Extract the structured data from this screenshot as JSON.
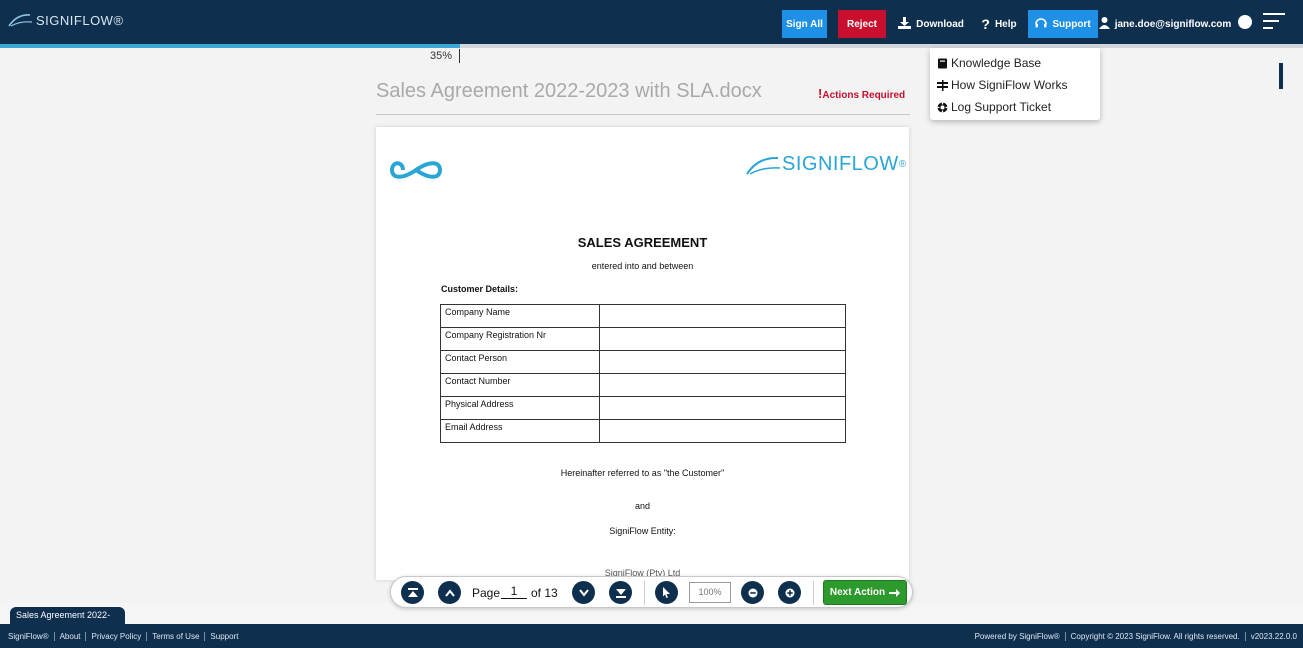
{
  "header": {
    "logo_text": "SIGNIFLOW®",
    "sign_all": "Sign All",
    "reject": "Reject",
    "download": "Download",
    "help": "Help",
    "support": "Support",
    "user_email": "jane.doe@signiflow.com",
    "colors": {
      "bar": "#0f2f4f",
      "sign_all": "#1e90e6",
      "reject": "#c8102e",
      "support": "#1e90e6"
    }
  },
  "support_menu": [
    {
      "label": "Knowledge Base",
      "icon": "book-icon"
    },
    {
      "label": "How SigniFlow Works",
      "icon": "signpost-icon"
    },
    {
      "label": "Log Support Ticket",
      "icon": "lifebuoy-icon"
    }
  ],
  "viewer": {
    "zoom_label": "35%",
    "document_title": "Sales Agreement 2022-2023 with SLA.docx",
    "actions_required": "Actions Required"
  },
  "document": {
    "logo_text": "SIGNIFLOW",
    "title": "SALES AGREEMENT",
    "subtitle": "entered into and between",
    "customer_label": "Customer Details:",
    "customer_fields": [
      "Company Name",
      "Company Registration Nr",
      "Contact Person",
      "Contact Number",
      "Physical Address",
      "Email Address"
    ],
    "hereinafter": "Hereinafter referred to as \"the Customer\"",
    "and": "and",
    "entity": "SigniFlow Entity:",
    "cut_text": "SigniFlow (Pty) Ltd"
  },
  "toolbar": {
    "page_label": "Page",
    "page_number": "1",
    "page_of": "of 13",
    "zoom_placeholder": "100%",
    "next_action": "Next Action"
  },
  "doc_tab": "Sales Agreement 2022-",
  "footer": {
    "left": [
      "SigniFlow®",
      "About",
      "Privacy Policy",
      "Terms of Use",
      "Support"
    ],
    "right": [
      "Powered by SigniFlow®",
      "Copyright © 2023 SigniFlow. All rights reserved.",
      "v2023.22.0.0"
    ]
  }
}
